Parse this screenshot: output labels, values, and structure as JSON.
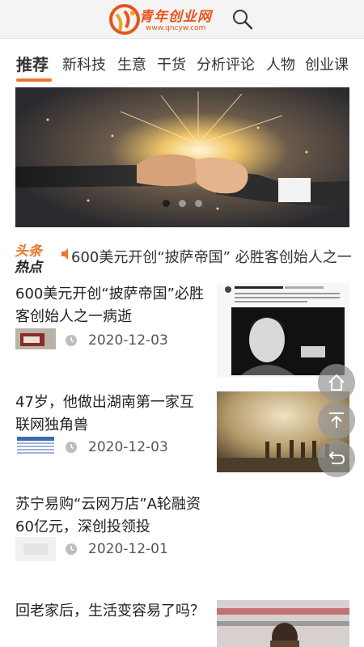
{
  "header": {
    "logo_name": "青年创业网",
    "logo_url": "www.qncyw.com",
    "search_icon": "search-icon",
    "brand_color": "#e8541c"
  },
  "tabs": [
    {
      "label": "推荐",
      "active": true
    },
    {
      "label": "新科技"
    },
    {
      "label": "生意"
    },
    {
      "label": "干货"
    },
    {
      "label": "分析评论"
    },
    {
      "label": "人物"
    },
    {
      "label": "创业课"
    }
  ],
  "banner": {
    "slide_count": 3,
    "current_slide": 1
  },
  "ticker": {
    "badge_line1": "头条",
    "badge_line2": "热点",
    "text": "600美元开创“披萨帝国” 必胜客创始人之一"
  },
  "news": [
    {
      "title": "600美元开创“披萨帝国”必胜客创始人之一病逝",
      "date": "2020-12-03",
      "image_caption_header": "The Original Pizza Hut Museum"
    },
    {
      "title": "47岁，他做出湖南第一家互联网独角兽",
      "date": "2020-12-03"
    },
    {
      "title": "苏宁易购“云网万店”A轮融资60亿元，深创投领投",
      "date": "2020-12-01"
    },
    {
      "title": "回老家后，生活变容易了吗？",
      "date": ""
    }
  ],
  "floating_buttons": [
    {
      "icon": "home-icon"
    },
    {
      "icon": "back-to-top-icon"
    },
    {
      "icon": "return-icon"
    }
  ],
  "colors": {
    "accent": "#e8782a",
    "fab": "#969696"
  }
}
